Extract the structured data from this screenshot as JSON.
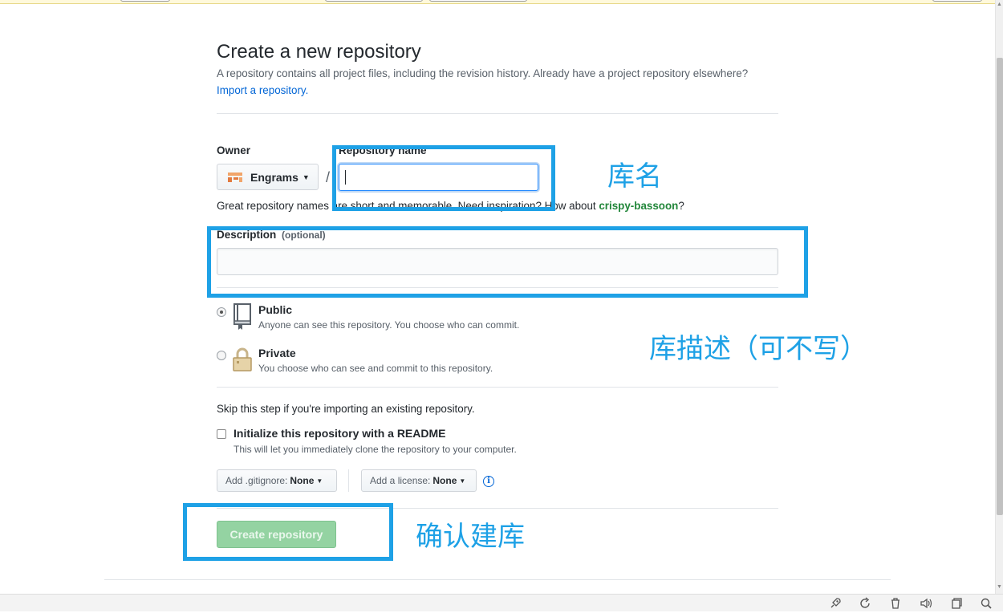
{
  "page": {
    "title": "Create a new repository",
    "subtitle": "A repository contains all project files, including the revision history. Already have a project repository elsewhere?",
    "import_link": "Import a repository."
  },
  "owner": {
    "label": "Owner",
    "value": "Engrams",
    "slash": "/"
  },
  "repo_name": {
    "label": "Repository name",
    "value": "",
    "hint_prefix": "Great repository names are short and memorable. Need inspiration? How about ",
    "suggestion": "crispy-bassoon",
    "hint_suffix": "?"
  },
  "description": {
    "label": "Description",
    "optional": "(optional)",
    "value": ""
  },
  "visibility": {
    "public": {
      "title": "Public",
      "desc": "Anyone can see this repository. You choose who can commit.",
      "checked": true
    },
    "private": {
      "title": "Private",
      "desc": "You choose who can see and commit to this repository.",
      "checked": false
    }
  },
  "init": {
    "skip_text": "Skip this step if you're importing an existing repository.",
    "readme_title": "Initialize this repository with a README",
    "readme_desc": "This will let you immediately clone the repository to your computer.",
    "readme_checked": false,
    "gitignore_label": "Add .gitignore:",
    "gitignore_value": "None",
    "license_label": "Add a license:",
    "license_value": "None",
    "info_glyph": "i"
  },
  "actions": {
    "create_label": "Create repository"
  },
  "annotations": {
    "repo_name_note": "库名",
    "description_note": "库描述（可不写）",
    "create_note": "确认建库",
    "color": "#1ea1e6"
  },
  "statusbar": {
    "icons": [
      "rocket-icon",
      "refresh-icon",
      "trash-icon",
      "volume-icon",
      "window-icon",
      "search-icon"
    ]
  }
}
